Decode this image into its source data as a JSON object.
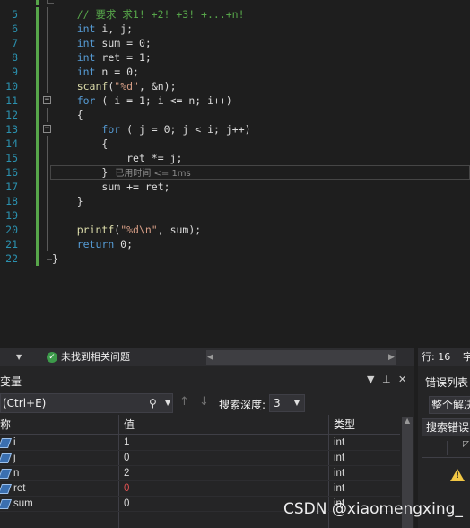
{
  "editor": {
    "lines": [
      {
        "no": "5",
        "indent": "    ",
        "parts": [
          {
            "cls": "cm",
            "text": "// 要求 求1! +2! +3! +...+n!"
          }
        ]
      },
      {
        "no": "6",
        "indent": "    ",
        "parts": [
          {
            "cls": "kw",
            "text": "int"
          },
          {
            "cls": "id",
            "text": " i, j;"
          }
        ]
      },
      {
        "no": "7",
        "indent": "    ",
        "parts": [
          {
            "cls": "kw",
            "text": "int"
          },
          {
            "cls": "id",
            "text": " sum = 0;"
          }
        ]
      },
      {
        "no": "8",
        "indent": "    ",
        "parts": [
          {
            "cls": "kw",
            "text": "int"
          },
          {
            "cls": "id",
            "text": " ret = 1;"
          }
        ]
      },
      {
        "no": "9",
        "indent": "    ",
        "parts": [
          {
            "cls": "kw",
            "text": "int"
          },
          {
            "cls": "id",
            "text": " n = 0;"
          }
        ]
      },
      {
        "no": "10",
        "indent": "    ",
        "parts": [
          {
            "cls": "fn",
            "text": "scanf"
          },
          {
            "cls": "id",
            "text": "("
          },
          {
            "cls": "st",
            "text": "\"%d\""
          },
          {
            "cls": "id",
            "text": ", &n);"
          }
        ]
      },
      {
        "no": "11",
        "indent": "    ",
        "fold": "−",
        "parts": [
          {
            "cls": "kw",
            "text": "for"
          },
          {
            "cls": "id",
            "text": " ( i = 1; i <= n; i++)"
          }
        ]
      },
      {
        "no": "12",
        "indent": "    ",
        "parts": [
          {
            "cls": "id",
            "text": "{"
          }
        ]
      },
      {
        "no": "13",
        "indent": "        ",
        "fold": "−",
        "parts": [
          {
            "cls": "kw",
            "text": "for"
          },
          {
            "cls": "id",
            "text": " ( j = 0; j < i; j++)"
          }
        ]
      },
      {
        "no": "14",
        "indent": "        ",
        "parts": [
          {
            "cls": "id",
            "text": "{"
          }
        ]
      },
      {
        "no": "15",
        "indent": "            ",
        "parts": [
          {
            "cls": "id",
            "text": "ret *= j;"
          }
        ]
      },
      {
        "no": "16",
        "indent": "        ",
        "current": true,
        "parts": [
          {
            "cls": "id",
            "text": "}"
          }
        ],
        "hint": "已用时间 <= 1ms"
      },
      {
        "no": "17",
        "indent": "        ",
        "parts": [
          {
            "cls": "id",
            "text": "sum += ret;"
          }
        ]
      },
      {
        "no": "18",
        "indent": "    ",
        "parts": [
          {
            "cls": "id",
            "text": "}"
          }
        ]
      },
      {
        "no": "19",
        "indent": "",
        "parts": []
      },
      {
        "no": "20",
        "indent": "    ",
        "parts": [
          {
            "cls": "fn",
            "text": "printf"
          },
          {
            "cls": "id",
            "text": "("
          },
          {
            "cls": "st",
            "text": "\"%d\\n\""
          },
          {
            "cls": "id",
            "text": ", sum);"
          }
        ]
      },
      {
        "no": "21",
        "indent": "    ",
        "parts": [
          {
            "cls": "kw",
            "text": "return"
          },
          {
            "cls": "id",
            "text": " 0;"
          }
        ]
      },
      {
        "no": "22",
        "indent": "",
        "parts": [
          {
            "cls": "id",
            "text": "}"
          }
        ]
      }
    ]
  },
  "status": {
    "issues_text": "未找到相关问题",
    "row": "行: 16",
    "col_partial": "字"
  },
  "locals": {
    "title": "变量",
    "search_placeholder": "(Ctrl+E)",
    "depth_label": "搜索深度:",
    "depth_value": "3",
    "columns": {
      "name": "称",
      "value": "值",
      "type": "类型"
    },
    "rows": [
      {
        "name": "i",
        "value": "1",
        "type": "int",
        "changed": false
      },
      {
        "name": "j",
        "value": "0",
        "type": "int",
        "changed": false
      },
      {
        "name": "n",
        "value": "2",
        "type": "int",
        "changed": false
      },
      {
        "name": "ret",
        "value": "0",
        "type": "int",
        "changed": true
      },
      {
        "name": "sum",
        "value": "0",
        "type": "int",
        "changed": false
      }
    ]
  },
  "errors": {
    "title": "错误列表",
    "scope": "整个解决",
    "search": "搜索错误"
  },
  "watermark": "CSDN @xiaomengxing_",
  "colors": {
    "keyword": "#569cd6",
    "comment": "#57a64a",
    "string": "#d69d85",
    "changed_value": "#e05252"
  }
}
